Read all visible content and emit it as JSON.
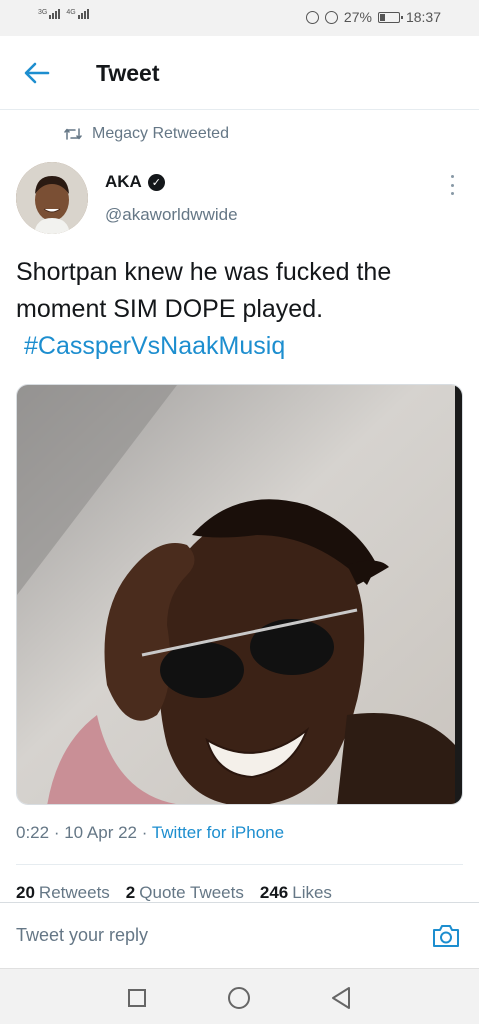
{
  "status_bar": {
    "signal_1": "3G",
    "signal_2": "4G",
    "battery": "27%",
    "time": "18:37"
  },
  "header": {
    "back_icon": "arrow-left-icon",
    "title": "Tweet"
  },
  "retweet": {
    "icon": "retweet-icon",
    "label": "Megacy Retweeted"
  },
  "tweet": {
    "author_name": "AKA",
    "verified_icon": "verified-badge-icon",
    "author_handle": "@akaworldwwide",
    "text": "Shortpan knew he was fucked the moment SIM DOPE played.",
    "hashtag": "#CassperVsNaakMusiq",
    "time": "0:22",
    "date": "10 Apr 22",
    "source": "Twitter for iPhone",
    "retweets_count": "20",
    "retweets_label": "Retweets",
    "quotes_count": "2",
    "quotes_label": "Quote Tweets",
    "likes_count": "246",
    "likes_label": "Likes"
  },
  "reply": {
    "placeholder": "Tweet your reply",
    "camera_icon": "camera-icon"
  },
  "colors": {
    "accent": "#1d8ecf",
    "muted": "#657786",
    "text": "#14171a"
  }
}
